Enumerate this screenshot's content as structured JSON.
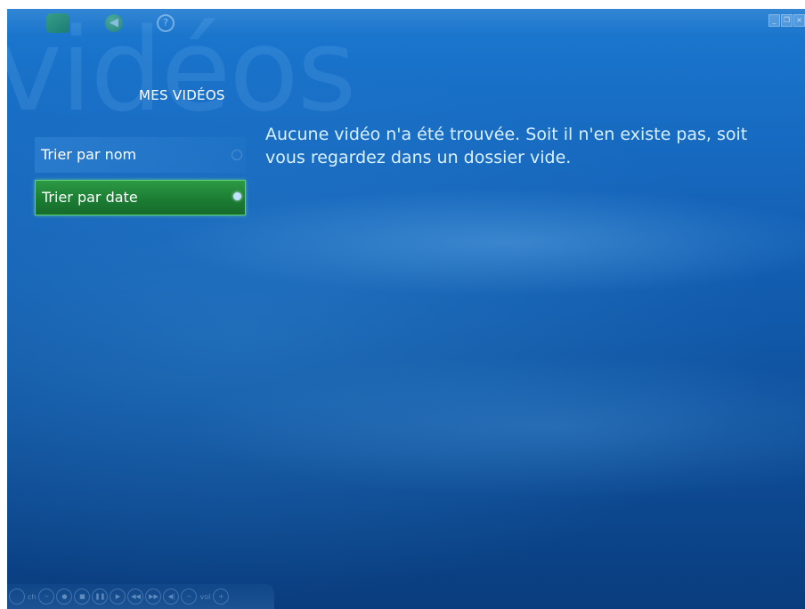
{
  "window": {
    "watermark": "vidéos",
    "controls": {
      "minimize": "_",
      "restore": "❐",
      "close": "×"
    }
  },
  "topbar": {
    "icons": [
      "media-center-logo-icon",
      "back-icon",
      "help-icon"
    ],
    "help_glyph": "?"
  },
  "section": {
    "title": "MES VIDÉOS"
  },
  "sort_menu": {
    "items": [
      {
        "label": "Trier par nom",
        "selected": false
      },
      {
        "label": "Trier par date",
        "selected": true
      }
    ]
  },
  "main": {
    "empty_message": "Aucune vidéo n'a été trouvée. Soit il n'en existe pas, soit vous regardez dans un dossier vide."
  },
  "transport": {
    "channel_label": "ch",
    "volume_label": "vol"
  },
  "colors": {
    "background": "#1462b8",
    "selected_item": "#1c7d33",
    "selected_border": "#5fd173",
    "message_text": "#d9f0ff"
  }
}
